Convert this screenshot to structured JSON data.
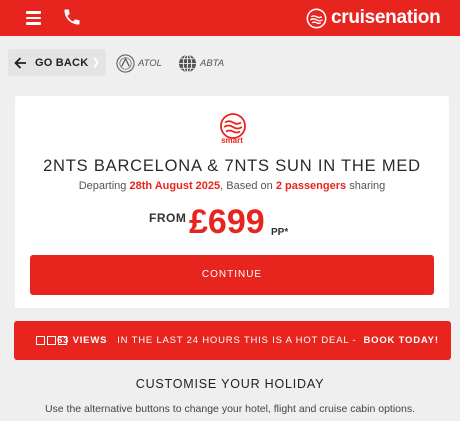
{
  "header": {
    "brand": "cruisenation",
    "menu_icon": "hamburger-menu-icon",
    "phone_icon": "phone-icon",
    "brand_color": "#e8241f"
  },
  "subheader": {
    "go_back_label": "GO BACK",
    "badges": [
      "ATOL",
      "ABTA"
    ]
  },
  "offer": {
    "logo_text": "smart",
    "title": "2NTS BARCELONA & 7NTS SUN IN THE MED",
    "departing_prefix": "Departing",
    "departing_date": "28th August 2025",
    "based_on": ", Based on",
    "passengers": "2 passengers",
    "sharing": "sharing",
    "price_from": "FROM",
    "price": "£699",
    "price_suffix": "PP*",
    "continue_label": "CONTINUE"
  },
  "deal_banner": {
    "views_label": "63 VIEWS",
    "text": "IN THE LAST 24 HOURS THIS IS A HOT DEAL -",
    "cta": "BOOK TODAY!"
  },
  "customise": {
    "title": "CUSTOMISE YOUR HOLIDAY",
    "subtitle": "Use the alternative buttons to change your hotel, flight and cruise cabin options."
  }
}
